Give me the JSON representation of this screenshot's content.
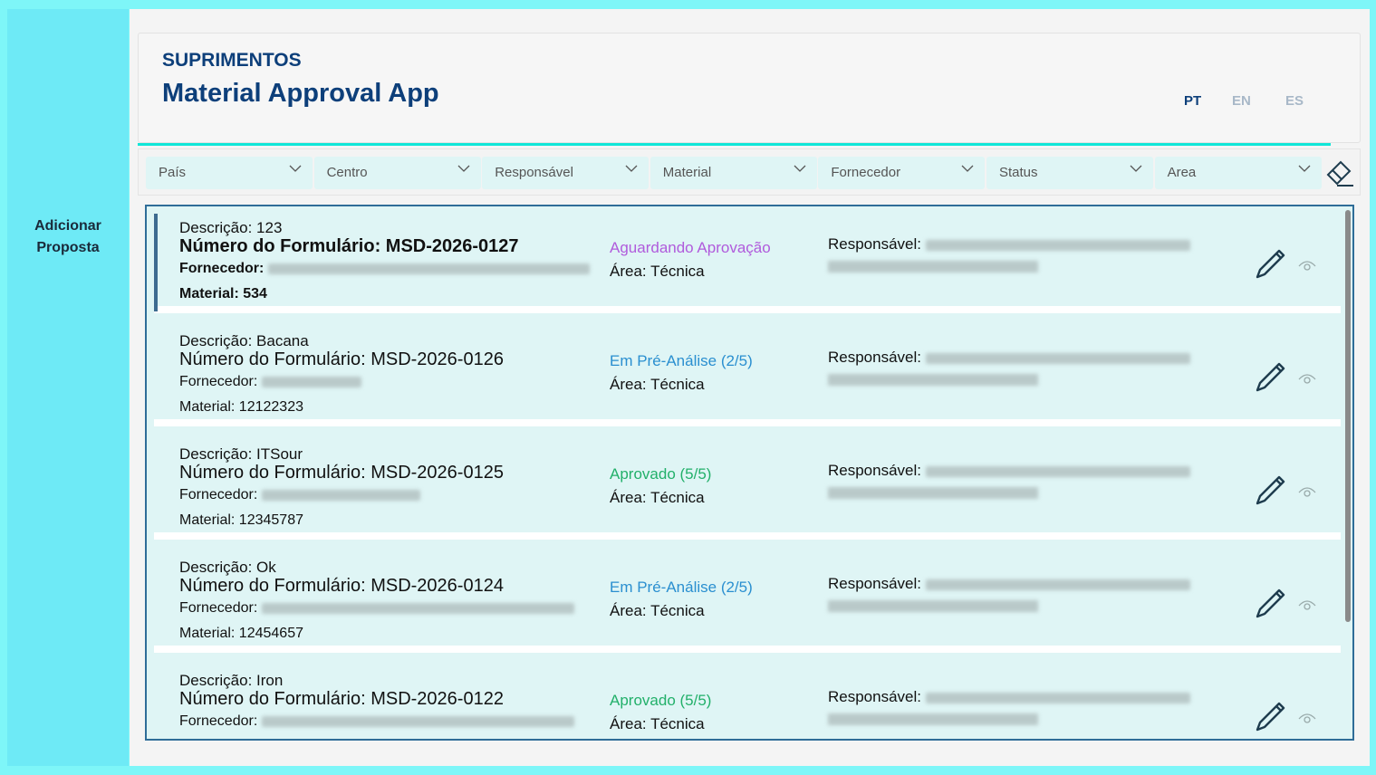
{
  "sidebar": {
    "add_label": "Adicionar Proposta"
  },
  "header": {
    "subtitle": "SUPRIMENTOS",
    "title": "Material Approval App",
    "languages": [
      "PT",
      "EN",
      "ES"
    ],
    "active_language": "PT"
  },
  "filters": [
    "País",
    "Centro",
    "Responsável",
    "Material",
    "Fornecedor",
    "Status",
    "Area"
  ],
  "labels": {
    "descricao": "Descrição: ",
    "numero": "Número do Formulário: ",
    "fornecedor": "Fornecedor: ",
    "material": "Material: ",
    "area": "Área: ",
    "responsavel": "Responsável: "
  },
  "colors": {
    "aguardando": "#b05bdc",
    "pre_analise": "#2a8fd0",
    "aprovado": "#22b06a"
  },
  "items": [
    {
      "descricao": "123",
      "numero": "MSD-2026-0127",
      "material": "534",
      "status": "Aguardando Aprovação",
      "status_type": "aguardando",
      "area": "Técnica"
    },
    {
      "descricao": "Bacana",
      "numero": "MSD-2026-0126",
      "material": "12122323",
      "status": "Em Pré-Análise (2/5)",
      "status_type": "pre_analise",
      "area": "Técnica"
    },
    {
      "descricao": "ITSour",
      "numero": "MSD-2026-0125",
      "material": "12345787",
      "status": "Aprovado (5/5)",
      "status_type": "aprovado",
      "area": "Técnica"
    },
    {
      "descricao": "Ok",
      "numero": "MSD-2026-0124",
      "material": "12454657",
      "status": "Em Pré-Análise (2/5)",
      "status_type": "pre_analise",
      "area": "Técnica"
    },
    {
      "descricao": "Iron",
      "numero": "MSD-2026-0122",
      "material": "",
      "status": "Aprovado (5/5)",
      "status_type": "aprovado",
      "area": "Técnica"
    }
  ]
}
